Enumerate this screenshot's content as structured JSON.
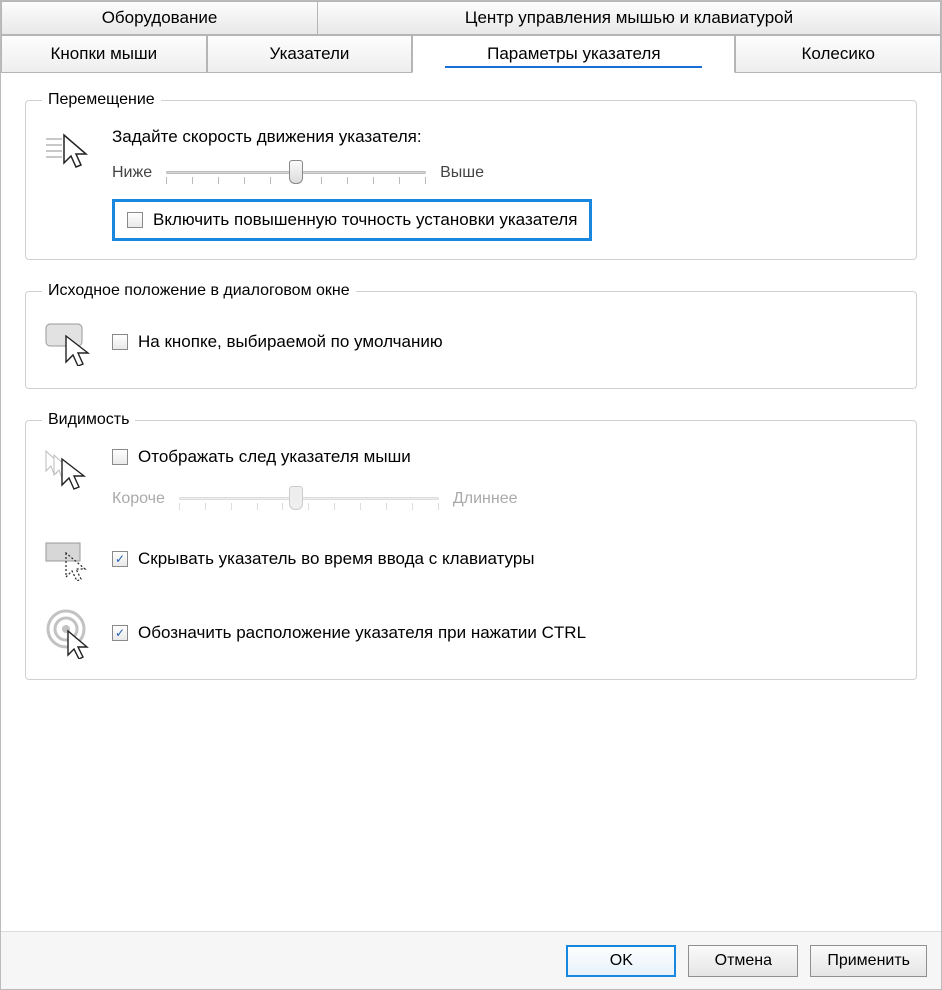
{
  "tabs_row1": [
    {
      "label": "Оборудование"
    },
    {
      "label": "Центр управления мышью и клавиатурой"
    }
  ],
  "tabs_row2": [
    {
      "label": "Кнопки мыши",
      "active": false
    },
    {
      "label": "Указатели",
      "active": false
    },
    {
      "label": "Параметры указателя",
      "active": true
    },
    {
      "label": "Колесико",
      "active": false
    }
  ],
  "group_motion": {
    "legend": "Перемещение",
    "heading": "Задайте скорость движения указателя:",
    "slider": {
      "low": "Ниже",
      "high": "Выше",
      "value": 6,
      "max": 11
    },
    "precision_checkbox": {
      "checked": false,
      "label": "Включить повышенную точность установки указателя"
    }
  },
  "group_snapto": {
    "legend": "Исходное положение в диалоговом окне",
    "checkbox": {
      "checked": false,
      "label": "На кнопке, выбираемой по умолчанию"
    }
  },
  "group_visibility": {
    "legend": "Видимость",
    "trails": {
      "checkbox": {
        "checked": false,
        "label": "Отображать след указателя мыши"
      },
      "slider": {
        "low": "Короче",
        "high": "Длиннее",
        "value": 5,
        "max": 11,
        "disabled": true
      }
    },
    "hide_typing": {
      "checked": true,
      "label": "Скрывать указатель во время ввода с клавиатуры"
    },
    "ctrl_locate": {
      "checked": true,
      "label": "Обозначить расположение указателя при нажатии CTRL"
    }
  },
  "buttons": {
    "ok": "OK",
    "cancel": "Отмена",
    "apply": "Применить"
  }
}
